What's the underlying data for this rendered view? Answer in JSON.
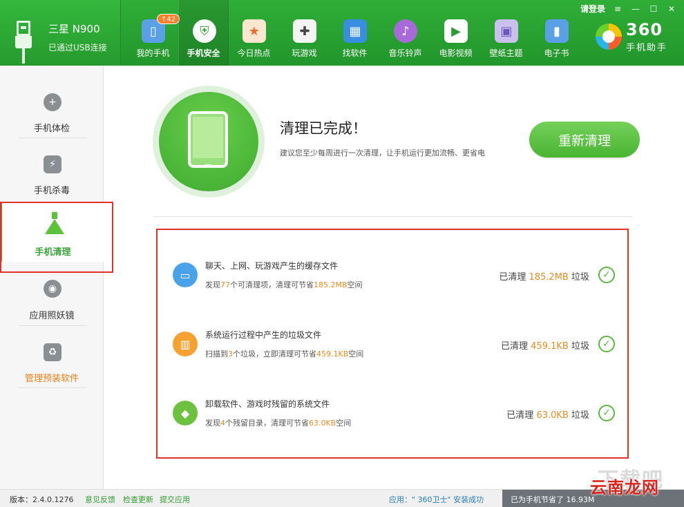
{
  "device": {
    "name": "三星 N900",
    "status": "已通过USB连接"
  },
  "nav": {
    "items": [
      {
        "label": "我的手机",
        "icon": "my-phone-icon",
        "badge": "↑42",
        "color": "#5aa0e6"
      },
      {
        "label": "手机安全",
        "icon": "shield-icon",
        "active": true,
        "color": "#ffffff"
      },
      {
        "label": "今日热点",
        "icon": "hot-news-icon",
        "color": "#f06a2a"
      },
      {
        "label": "玩游戏",
        "icon": "gamepad-icon",
        "color": "#ffffff"
      },
      {
        "label": "找软件",
        "icon": "app-store-icon",
        "color": "#3a8ee0"
      },
      {
        "label": "音乐铃声",
        "icon": "music-icon",
        "color": "#a86ad8"
      },
      {
        "label": "电影视频",
        "icon": "video-icon",
        "color": "#2d9a3a"
      },
      {
        "label": "壁纸主题",
        "icon": "wallpaper-icon",
        "color": "#8a78d0"
      },
      {
        "label": "电子书",
        "icon": "ebook-icon",
        "color": "#5aa0e6"
      }
    ]
  },
  "logo": {
    "number": "360",
    "subtitle": "手机助手"
  },
  "window": {
    "login": "请登录"
  },
  "sidebar": {
    "items": [
      {
        "label": "手机体检",
        "icon": "checkup-icon"
      },
      {
        "label": "手机杀毒",
        "icon": "antivirus-icon"
      },
      {
        "label": "手机清理",
        "icon": "broom-icon",
        "active": true
      },
      {
        "label": "应用照妖镜",
        "icon": "app-mirror-icon"
      },
      {
        "label": "管理预装软件",
        "icon": "preinstalled-app-icon"
      }
    ]
  },
  "main": {
    "title": "清理已完成！",
    "subtitle": "建议您至少每周进行一次清理，让手机运行更加流畅、更省电",
    "reclean_label": "重新清理",
    "rows": [
      {
        "title": "聊天、上网、玩游戏产生的缓存文件",
        "desc_pre": "发现",
        "desc_count": "77",
        "desc_mid": "个可清理项，清理可节省",
        "desc_size": "185.2MB",
        "desc_post": "空间",
        "stat_pre": "已清理",
        "stat_size": "185.2MB",
        "stat_post": "垃圾",
        "icon": "cache-files-icon",
        "color": "#4aa3e8"
      },
      {
        "title": "系统运行过程中产生的垃圾文件",
        "desc_pre": "扫描到",
        "desc_count": "3",
        "desc_mid": "个垃圾，立即清理可节省",
        "desc_size": "459.1KB",
        "desc_post": "空间",
        "stat_pre": "已清理",
        "stat_size": "459.1KB",
        "stat_post": "垃圾",
        "icon": "trash-bin-icon",
        "color": "#f5a233"
      },
      {
        "title": "卸载软件、游戏时残留的系统文件",
        "desc_pre": "发现",
        "desc_count": "4",
        "desc_mid": "个残留目录，清理可节省",
        "desc_size": "63.0KB",
        "desc_post": "空间",
        "stat_pre": "已清理",
        "stat_size": "63.0KB",
        "stat_post": "垃圾",
        "icon": "residual-files-icon",
        "color": "#6cc23e"
      }
    ]
  },
  "status": {
    "version": "版本：2.4.0.1276",
    "links": [
      "意见反馈",
      "检查更新",
      "提交应用"
    ],
    "install": "应用：\" 360卫士\" 安装成功",
    "saved": "已为手机节省了 16.93M"
  },
  "watermark": {
    "gray": "下载吧",
    "red": "云南龙网"
  }
}
